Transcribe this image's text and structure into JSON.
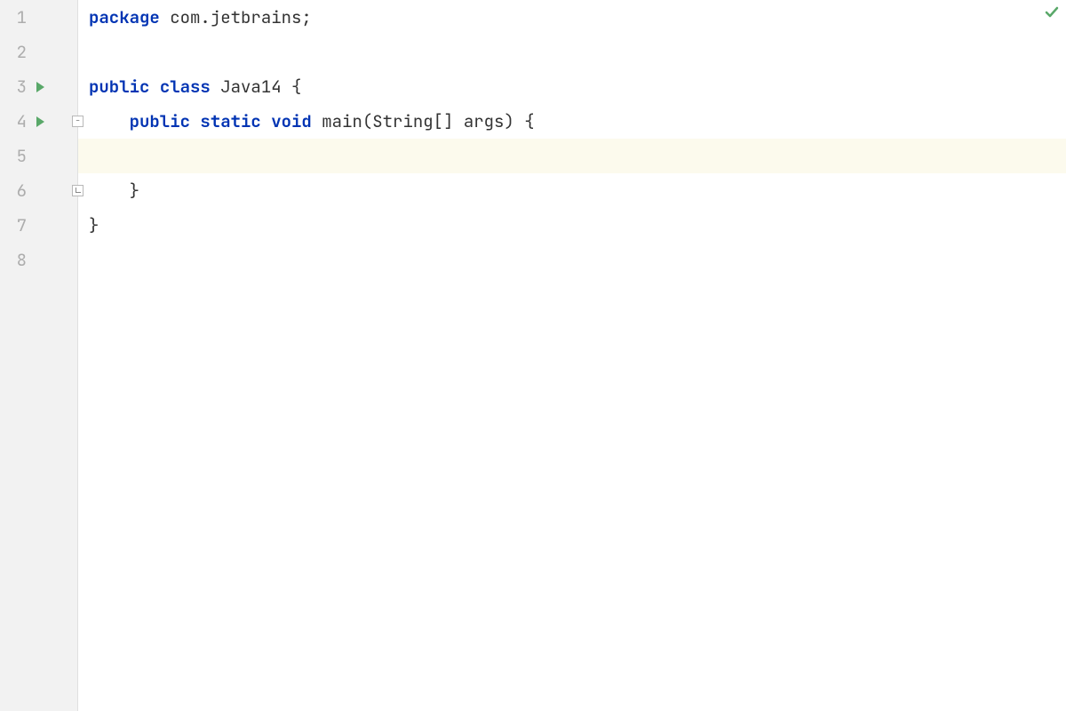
{
  "colors": {
    "gutter_bg": "#f2f2f2",
    "keyword": "#0033b3",
    "run_icon": "#59a869",
    "line_number": "#adadad",
    "highlight": "#fcfaed",
    "status_ok": "#59a869"
  },
  "editor": {
    "lines": [
      {
        "num": "1",
        "run": false,
        "fold": null
      },
      {
        "num": "2",
        "run": false,
        "fold": null
      },
      {
        "num": "3",
        "run": true,
        "fold": null
      },
      {
        "num": "4",
        "run": true,
        "fold": "top"
      },
      {
        "num": "5",
        "run": false,
        "fold": null,
        "highlight": true
      },
      {
        "num": "6",
        "run": false,
        "fold": "bottom"
      },
      {
        "num": "7",
        "run": false,
        "fold": null
      },
      {
        "num": "8",
        "run": false,
        "fold": null
      }
    ],
    "code": {
      "l1": {
        "kw_package": "package",
        "pkg": " com.jetbrains",
        "semi": ";"
      },
      "l2": {
        "text": ""
      },
      "l3": {
        "kw_public": "public",
        "kw_class": "class",
        "name": "Java14",
        "brace": "{"
      },
      "l4": {
        "indent": "    ",
        "kw_public": "public",
        "kw_static": "static",
        "kw_void": "void",
        "fn": "main",
        "params": "(String[] args)",
        "brace": "{"
      },
      "l5": {
        "text": "        "
      },
      "l6": {
        "indent": "    ",
        "brace": "}"
      },
      "l7": {
        "brace": "}"
      },
      "l8": {
        "text": ""
      }
    }
  },
  "icons": {
    "run": "run-icon",
    "fold_collapse": "fold-collapse-icon",
    "status_ok": "status-ok-icon"
  }
}
